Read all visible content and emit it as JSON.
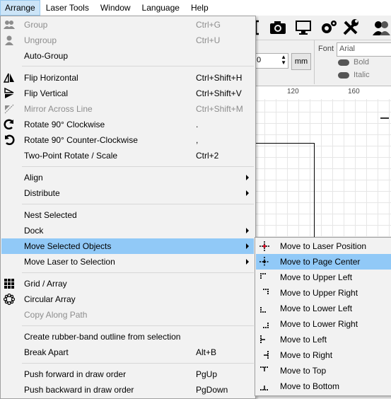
{
  "menubar": {
    "items": [
      {
        "label": "Arrange"
      },
      {
        "label": "Laser Tools"
      },
      {
        "label": "Window"
      },
      {
        "label": "Language"
      },
      {
        "label": "Help"
      }
    ]
  },
  "props": {
    "font_label": "Font",
    "font_value": "Arial",
    "bold_label": "Bold",
    "italic_label": "Italic",
    "unit_label": "mm",
    "number_partial": "0"
  },
  "ruler": {
    "labels": [
      "120",
      "160"
    ]
  },
  "arrange_menu": {
    "items": [
      {
        "label": "Group",
        "shortcut": "Ctrl+G"
      },
      {
        "label": "Ungroup",
        "shortcut": "Ctrl+U"
      },
      {
        "label": "Auto-Group",
        "shortcut": ""
      },
      {
        "label": "Flip Horizontal",
        "shortcut": "Ctrl+Shift+H"
      },
      {
        "label": "Flip Vertical",
        "shortcut": "Ctrl+Shift+V"
      },
      {
        "label": "Mirror Across Line",
        "shortcut": "Ctrl+Shift+M"
      },
      {
        "label": "Rotate 90° Clockwise",
        "shortcut": "."
      },
      {
        "label": "Rotate 90° Counter-Clockwise",
        "shortcut": ","
      },
      {
        "label": "Two-Point Rotate / Scale",
        "shortcut": "Ctrl+2"
      },
      {
        "label": "Align",
        "shortcut": ""
      },
      {
        "label": "Distribute",
        "shortcut": ""
      },
      {
        "label": "Nest Selected",
        "shortcut": ""
      },
      {
        "label": "Dock",
        "shortcut": ""
      },
      {
        "label": "Move Selected Objects",
        "shortcut": ""
      },
      {
        "label": "Move Laser to Selection",
        "shortcut": ""
      },
      {
        "label": "Grid / Array",
        "shortcut": ""
      },
      {
        "label": "Circular Array",
        "shortcut": ""
      },
      {
        "label": "Copy Along Path",
        "shortcut": ""
      },
      {
        "label": "Create rubber-band outline from selection",
        "shortcut": ""
      },
      {
        "label": "Break Apart",
        "shortcut": "Alt+B"
      },
      {
        "label": "Push forward in draw order",
        "shortcut": "PgUp"
      },
      {
        "label": "Push backward in draw order",
        "shortcut": "PgDown"
      }
    ]
  },
  "move_submenu": {
    "items": [
      {
        "label": "Move to Laser Position"
      },
      {
        "label": "Move to Page Center"
      },
      {
        "label": "Move to Upper Left"
      },
      {
        "label": "Move to Upper Right"
      },
      {
        "label": "Move to Lower Left"
      },
      {
        "label": "Move to Lower Right"
      },
      {
        "label": "Move to Left"
      },
      {
        "label": "Move to Right"
      },
      {
        "label": "Move to Top"
      },
      {
        "label": "Move to Bottom"
      }
    ]
  },
  "colors": {
    "highlight": "#91c9f7",
    "menu_bg": "#f2f2f2",
    "disabled_text": "#8d8d8d",
    "accent_red": "#d0021b"
  }
}
